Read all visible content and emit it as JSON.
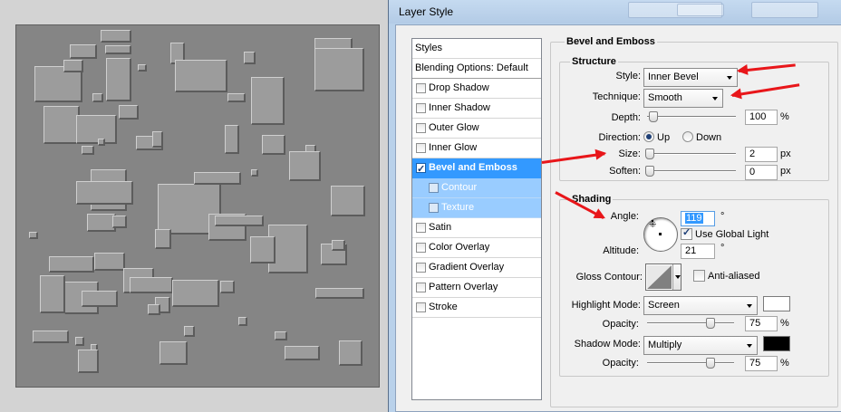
{
  "window": {
    "title": "Layer Style"
  },
  "style_list": {
    "header": "Styles",
    "blending": "Blending Options: Default",
    "items": [
      {
        "label": "Drop Shadow",
        "checked": false,
        "state": "normal"
      },
      {
        "label": "Inner Shadow",
        "checked": false,
        "state": "normal"
      },
      {
        "label": "Outer Glow",
        "checked": false,
        "state": "normal"
      },
      {
        "label": "Inner Glow",
        "checked": false,
        "state": "normal"
      },
      {
        "label": "Bevel and Emboss",
        "checked": true,
        "state": "selected"
      },
      {
        "label": "Contour",
        "checked": false,
        "state": "sub"
      },
      {
        "label": "Texture",
        "checked": false,
        "state": "sub"
      },
      {
        "label": "Satin",
        "checked": false,
        "state": "normal"
      },
      {
        "label": "Color Overlay",
        "checked": false,
        "state": "normal"
      },
      {
        "label": "Gradient Overlay",
        "checked": false,
        "state": "normal"
      },
      {
        "label": "Pattern Overlay",
        "checked": false,
        "state": "normal"
      },
      {
        "label": "Stroke",
        "checked": false,
        "state": "normal"
      }
    ]
  },
  "bevel": {
    "group_title": "Bevel and Emboss",
    "structure": {
      "title": "Structure",
      "style_label": "Style:",
      "style_value": "Inner Bevel",
      "technique_label": "Technique:",
      "technique_value": "Smooth",
      "depth_label": "Depth:",
      "depth_value": "100",
      "depth_unit": "%",
      "depth_level": 0.02,
      "direction_label": "Direction:",
      "direction_up": "Up",
      "direction_down": "Down",
      "direction_selected": "Up",
      "size_label": "Size:",
      "size_value": "2",
      "size_unit": "px",
      "size_level": 0.0,
      "soften_label": "Soften:",
      "soften_value": "0",
      "soften_unit": "px",
      "soften_level": 0.0
    },
    "shading": {
      "title": "Shading",
      "angle_label": "Angle:",
      "angle_value": "119",
      "angle_unit": "°",
      "global_light_label": "Use Global Light",
      "global_light_checked": true,
      "altitude_label": "Altitude:",
      "altitude_value": "21",
      "altitude_unit": "°",
      "gloss_label": "Gloss Contour:",
      "antialiased_label": "Anti-aliased",
      "antialiased_checked": false,
      "highlight_mode_label": "Highlight Mode:",
      "highlight_mode_value": "Screen",
      "highlight_color": "#ffffff",
      "highlight_opacity_label": "Opacity:",
      "highlight_opacity_value": "75",
      "highlight_opacity_unit": "%",
      "highlight_opacity_level": 0.75,
      "shadow_mode_label": "Shadow Mode:",
      "shadow_mode_value": "Multiply",
      "shadow_color": "#000000",
      "shadow_opacity_label": "Opacity:",
      "shadow_opacity_value": "75",
      "shadow_opacity_unit": "%",
      "shadow_opacity_level": 0.75
    }
  },
  "colors": {
    "accent": "#3399ff",
    "annotation": "#e8161a",
    "canvas_bg": "#858585"
  }
}
